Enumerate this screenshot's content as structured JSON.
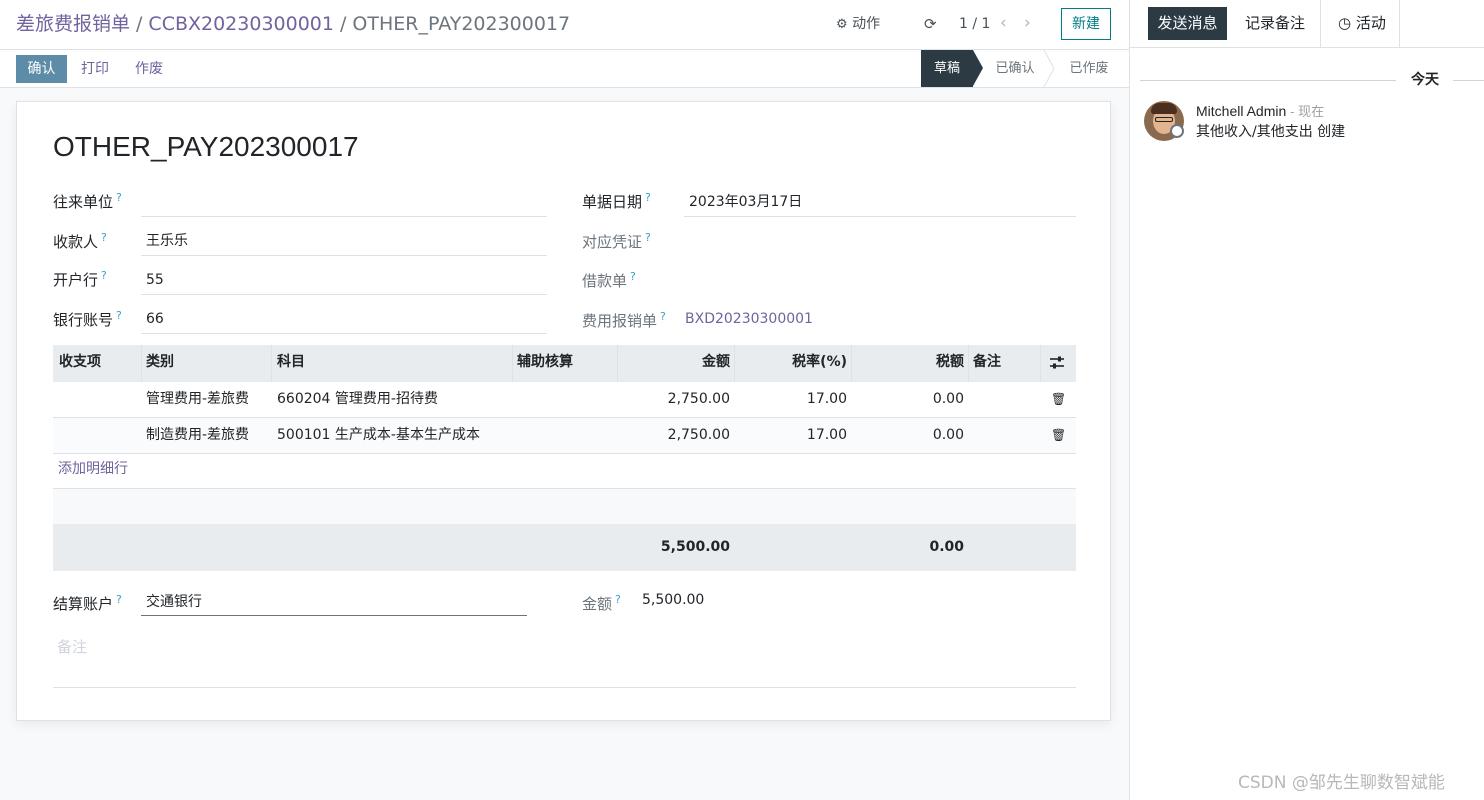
{
  "breadcrumb": {
    "root": "差旅费报销单",
    "parent": "CCBX20230300001",
    "current": "OTHER_PAY202300017",
    "sep": "/"
  },
  "toolbar": {
    "action_label": "动作",
    "pager_value": "1 / 1",
    "new_label": "新建",
    "confirm_label": "确认",
    "print_label": "打印",
    "cancel_label": "作废"
  },
  "statusbar": {
    "stages": [
      "草稿",
      "已确认",
      "已作废"
    ],
    "active": "草稿"
  },
  "form": {
    "title": "OTHER_PAY202300017",
    "help_mark": "?",
    "partner_label": "往来单位",
    "partner_value": "",
    "payee_label": "收款人",
    "payee_value": "王乐乐",
    "bank_label": "开户行",
    "bank_value": "55",
    "account_label": "银行账号",
    "account_value": "66",
    "date_label": "单据日期",
    "date_value": "2023年03月17日",
    "voucher_label": "对应凭证",
    "voucher_value": "",
    "loan_label": "借款单",
    "loan_value": "",
    "expense_label": "费用报销单",
    "expense_value": "BXD20230300001",
    "settle_label": "结算账户",
    "settle_value": "交通银行",
    "amount_label": "金额",
    "amount_value": "5,500.00",
    "note_placeholder": "备注"
  },
  "lines": {
    "headers": [
      "收支项",
      "类别",
      "科目",
      "辅助核算",
      "金额",
      "税率(%)",
      "税额",
      "备注"
    ],
    "rows": [
      {
        "item": "",
        "category": "管理费用-差旅费",
        "account": "660204 管理费用-招待费",
        "analytic": "",
        "amount": "2,750.00",
        "tax_rate": "17.00",
        "tax": "0.00",
        "note": ""
      },
      {
        "item": "",
        "category": "制造费用-差旅费",
        "account": "500101 生产成本-基本生产成本",
        "analytic": "",
        "amount": "2,750.00",
        "tax_rate": "17.00",
        "tax": "0.00",
        "note": ""
      }
    ],
    "add_line_label": "添加明细行",
    "total_amount": "5,500.00",
    "total_tax": "0.00"
  },
  "chatter": {
    "send_label": "发送消息",
    "log_label": "记录备注",
    "activity_label": "活动",
    "date_separator": "今天",
    "messages": [
      {
        "author": "Mitchell Admin",
        "time": "现在",
        "body": "其他收入/其他支出 创建"
      }
    ]
  },
  "watermark": "CSDN @邹先生聊数智斌能",
  "icons": {
    "gear": "gear-icon",
    "refresh": "refresh-icon",
    "prev": "chevron-left-icon",
    "next": "chevron-right-icon",
    "trash": "trash-icon",
    "columns": "sliders-icon",
    "clock": "clock-icon"
  },
  "colors": {
    "brand": "#71639e",
    "primary_button": "#5d8ca8",
    "dark": "#2c3a44",
    "teal": "#017e84"
  }
}
